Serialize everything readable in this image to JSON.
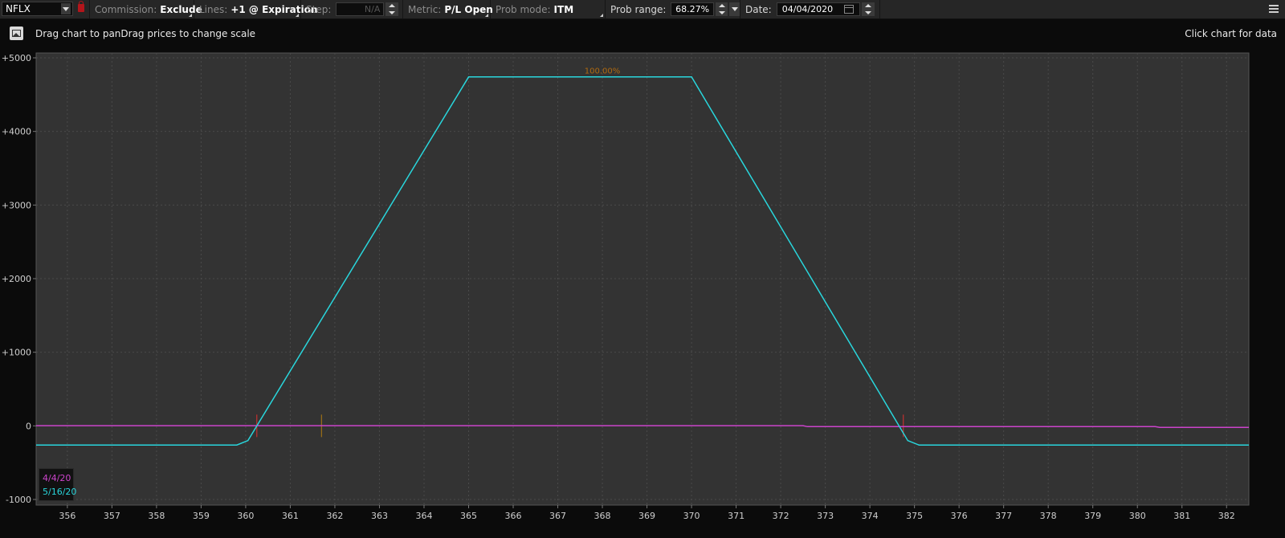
{
  "toolbar": {
    "symbol": "NFLX",
    "commission_label": "Commission:",
    "commission_value": "Exclude",
    "lines_label": "Lines:",
    "lines_value": "+1 @ Expiration",
    "step_label": "Step:",
    "step_value": "N/A",
    "metric_label": "Metric:",
    "metric_value": "P/L Open",
    "prob_mode_label": "Prob mode:",
    "prob_mode_value": "ITM",
    "prob_range_label": "Prob range:",
    "prob_range_value": "68.27%",
    "date_label": "Date:",
    "date_value": "04/04/2020"
  },
  "info": {
    "hint": "Drag chart to panDrag prices to change scale",
    "click_hint": "Click chart for data"
  },
  "colors": {
    "expiration_line": "#29d6dc",
    "current_line": "#cc44cc",
    "prob_label": "#b06a10",
    "background": "#333333"
  },
  "chart_data": {
    "type": "line",
    "xlim": [
      355.3,
      382.5
    ],
    "ylim": [
      -1000,
      5000
    ],
    "x_ticks": [
      356,
      357,
      358,
      359,
      360,
      361,
      362,
      363,
      364,
      365,
      366,
      367,
      368,
      369,
      370,
      371,
      372,
      373,
      374,
      375,
      376,
      377,
      378,
      379,
      380,
      381,
      382
    ],
    "y_ticks": [
      {
        "value": 5000,
        "label": "+5000"
      },
      {
        "value": 4000,
        "label": "+4000"
      },
      {
        "value": 3000,
        "label": "+3000"
      },
      {
        "value": 2000,
        "label": "+2000"
      },
      {
        "value": 1000,
        "label": "+1000"
      },
      {
        "value": 0,
        "label": "0"
      },
      {
        "value": -1000,
        "label": "-1000"
      }
    ],
    "series": [
      {
        "name": "5/16/20",
        "color": "#29d6dc",
        "points": [
          [
            355.3,
            -260
          ],
          [
            359.8,
            -260
          ],
          [
            360.05,
            -200
          ],
          [
            365.0,
            4740
          ],
          [
            370.0,
            4740
          ],
          [
            374.85,
            -200
          ],
          [
            375.1,
            -260
          ],
          [
            382.5,
            -260
          ]
        ]
      },
      {
        "name": "4/4/20",
        "color": "#cc44cc",
        "points": [
          [
            355.3,
            2
          ],
          [
            372.5,
            2
          ],
          [
            372.6,
            -10
          ],
          [
            380.4,
            -10
          ],
          [
            380.5,
            -20
          ],
          [
            382.5,
            -20
          ]
        ]
      }
    ],
    "annotations": [
      {
        "text": "100.00%",
        "x": 368.0,
        "y": 4790
      }
    ],
    "markers": [
      {
        "x": 360.25,
        "color": "#e03030"
      },
      {
        "x": 361.7,
        "color": "#b07a10"
      },
      {
        "x": 374.75,
        "color": "#e03030"
      }
    ],
    "grid": true
  }
}
